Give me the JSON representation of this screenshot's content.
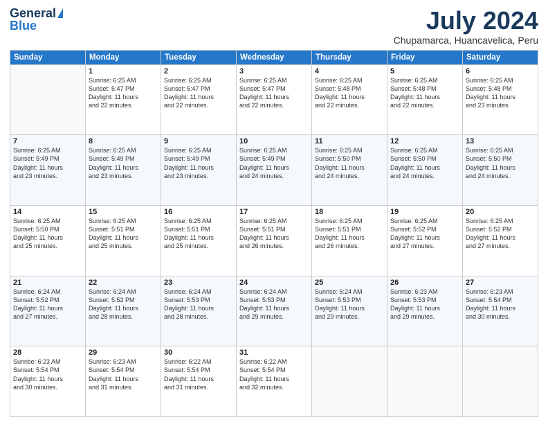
{
  "logo": {
    "general": "General",
    "blue": "Blue"
  },
  "title": "July 2024",
  "subtitle": "Chupamarca, Huancavelica, Peru",
  "headers": [
    "Sunday",
    "Monday",
    "Tuesday",
    "Wednesday",
    "Thursday",
    "Friday",
    "Saturday"
  ],
  "weeks": [
    [
      {
        "day": "",
        "info": ""
      },
      {
        "day": "1",
        "info": "Sunrise: 6:25 AM\nSunset: 5:47 PM\nDaylight: 11 hours\nand 22 minutes."
      },
      {
        "day": "2",
        "info": "Sunrise: 6:25 AM\nSunset: 5:47 PM\nDaylight: 11 hours\nand 22 minutes."
      },
      {
        "day": "3",
        "info": "Sunrise: 6:25 AM\nSunset: 5:47 PM\nDaylight: 11 hours\nand 22 minutes."
      },
      {
        "day": "4",
        "info": "Sunrise: 6:25 AM\nSunset: 5:48 PM\nDaylight: 11 hours\nand 22 minutes."
      },
      {
        "day": "5",
        "info": "Sunrise: 6:25 AM\nSunset: 5:48 PM\nDaylight: 11 hours\nand 22 minutes."
      },
      {
        "day": "6",
        "info": "Sunrise: 6:25 AM\nSunset: 5:48 PM\nDaylight: 11 hours\nand 23 minutes."
      }
    ],
    [
      {
        "day": "7",
        "info": "Sunrise: 6:25 AM\nSunset: 5:49 PM\nDaylight: 11 hours\nand 23 minutes."
      },
      {
        "day": "8",
        "info": "Sunrise: 6:25 AM\nSunset: 5:49 PM\nDaylight: 11 hours\nand 23 minutes."
      },
      {
        "day": "9",
        "info": "Sunrise: 6:25 AM\nSunset: 5:49 PM\nDaylight: 11 hours\nand 23 minutes."
      },
      {
        "day": "10",
        "info": "Sunrise: 6:25 AM\nSunset: 5:49 PM\nDaylight: 11 hours\nand 24 minutes."
      },
      {
        "day": "11",
        "info": "Sunrise: 6:25 AM\nSunset: 5:50 PM\nDaylight: 11 hours\nand 24 minutes."
      },
      {
        "day": "12",
        "info": "Sunrise: 6:25 AM\nSunset: 5:50 PM\nDaylight: 11 hours\nand 24 minutes."
      },
      {
        "day": "13",
        "info": "Sunrise: 6:25 AM\nSunset: 5:50 PM\nDaylight: 11 hours\nand 24 minutes."
      }
    ],
    [
      {
        "day": "14",
        "info": "Sunrise: 6:25 AM\nSunset: 5:50 PM\nDaylight: 11 hours\nand 25 minutes."
      },
      {
        "day": "15",
        "info": "Sunrise: 6:25 AM\nSunset: 5:51 PM\nDaylight: 11 hours\nand 25 minutes."
      },
      {
        "day": "16",
        "info": "Sunrise: 6:25 AM\nSunset: 5:51 PM\nDaylight: 11 hours\nand 25 minutes."
      },
      {
        "day": "17",
        "info": "Sunrise: 6:25 AM\nSunset: 5:51 PM\nDaylight: 11 hours\nand 26 minutes."
      },
      {
        "day": "18",
        "info": "Sunrise: 6:25 AM\nSunset: 5:51 PM\nDaylight: 11 hours\nand 26 minutes."
      },
      {
        "day": "19",
        "info": "Sunrise: 6:25 AM\nSunset: 5:52 PM\nDaylight: 11 hours\nand 27 minutes."
      },
      {
        "day": "20",
        "info": "Sunrise: 6:25 AM\nSunset: 5:52 PM\nDaylight: 11 hours\nand 27 minutes."
      }
    ],
    [
      {
        "day": "21",
        "info": "Sunrise: 6:24 AM\nSunset: 5:52 PM\nDaylight: 11 hours\nand 27 minutes."
      },
      {
        "day": "22",
        "info": "Sunrise: 6:24 AM\nSunset: 5:52 PM\nDaylight: 11 hours\nand 28 minutes."
      },
      {
        "day": "23",
        "info": "Sunrise: 6:24 AM\nSunset: 5:53 PM\nDaylight: 11 hours\nand 28 minutes."
      },
      {
        "day": "24",
        "info": "Sunrise: 6:24 AM\nSunset: 5:53 PM\nDaylight: 11 hours\nand 29 minutes."
      },
      {
        "day": "25",
        "info": "Sunrise: 6:24 AM\nSunset: 5:53 PM\nDaylight: 11 hours\nand 29 minutes."
      },
      {
        "day": "26",
        "info": "Sunrise: 6:23 AM\nSunset: 5:53 PM\nDaylight: 11 hours\nand 29 minutes."
      },
      {
        "day": "27",
        "info": "Sunrise: 6:23 AM\nSunset: 5:54 PM\nDaylight: 11 hours\nand 30 minutes."
      }
    ],
    [
      {
        "day": "28",
        "info": "Sunrise: 6:23 AM\nSunset: 5:54 PM\nDaylight: 11 hours\nand 30 minutes."
      },
      {
        "day": "29",
        "info": "Sunrise: 6:23 AM\nSunset: 5:54 PM\nDaylight: 11 hours\nand 31 minutes."
      },
      {
        "day": "30",
        "info": "Sunrise: 6:22 AM\nSunset: 5:54 PM\nDaylight: 11 hours\nand 31 minutes."
      },
      {
        "day": "31",
        "info": "Sunrise: 6:22 AM\nSunset: 5:54 PM\nDaylight: 11 hours\nand 32 minutes."
      },
      {
        "day": "",
        "info": ""
      },
      {
        "day": "",
        "info": ""
      },
      {
        "day": "",
        "info": ""
      }
    ]
  ]
}
